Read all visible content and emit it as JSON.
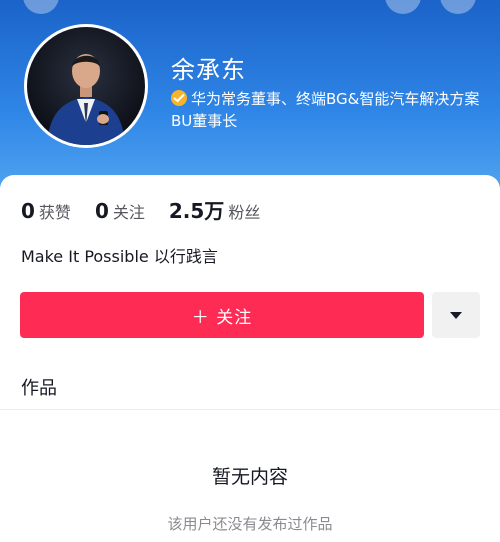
{
  "profile": {
    "name": "余承东",
    "verification": "华为常务董事、终端BG&智能汽车解决方案BU董事长",
    "bio": "Make It Possible 以行践言"
  },
  "stats": {
    "likes": {
      "value": "0",
      "label": "获赞"
    },
    "following": {
      "value": "0",
      "label": "关注"
    },
    "followers": {
      "value": "2.5万",
      "label": "粉丝"
    }
  },
  "actions": {
    "follow_label": "＋ 关注"
  },
  "tabs": {
    "works_label": "作品"
  },
  "empty_state": {
    "title": "暂无内容",
    "description": "该用户还没有发布过作品"
  },
  "colors": {
    "header_blue": "#2f86e6",
    "follow_button": "#fe2c55",
    "verified_badge": "#f5b42a"
  },
  "icons": [
    "back-icon",
    "share-icon",
    "more-icon",
    "verified-icon",
    "caret-down-icon"
  ]
}
